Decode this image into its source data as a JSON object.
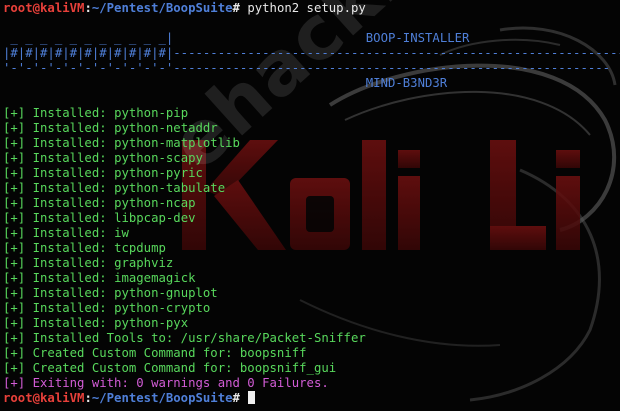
{
  "prompt": {
    "user_host": "root@kaliVM",
    "colon": ":",
    "path": "~/Pentest/BoopSuite",
    "hash": "#"
  },
  "command": "python2 setup.py",
  "banner": {
    "line1": "                                       ",
    "line2": " _ _ _ _ _ _ _ _ _ _ _|",
    "line3": "|#|#|#|#|#|#|#|#|#|#|#|",
    "line3_rule": "----------------------------------------------------------------/",
    "line4": "'-'-'-'-'-'-'-'-'-'-'-'-----------------------------------------------------------",
    "title": "BOOP-INSTALLER",
    "author": "MIND-B3ND3R"
  },
  "installed_prefix": "[+] Installed: ",
  "installed": [
    "python-pip",
    "python-netaddr",
    "python-matplotlib",
    "python-scapy",
    "python-pyric",
    "python-tabulate",
    "python-ncap",
    "libpcap-dev",
    "iw",
    "tcpdump",
    "graphviz",
    "imagemagick",
    "python-gnuplot",
    "python-crypto",
    "python-pyx"
  ],
  "messages": {
    "tools": "[+] Installed Tools to: /usr/share/Packet-Sniffer",
    "cmd1": "[+] Created Custom Command for: boopsniff",
    "cmd2": "[+] Created Custom Command for: boopsniff_gui",
    "exit": "[+] Exiting with: 0 warnings and 0 Failures."
  },
  "watermark": "ehacking.net",
  "colors": {
    "prompt_user": "#e8403a",
    "prompt_path": "#4f7fd8",
    "success": "#58d85c",
    "exit": "#d25cd6"
  }
}
